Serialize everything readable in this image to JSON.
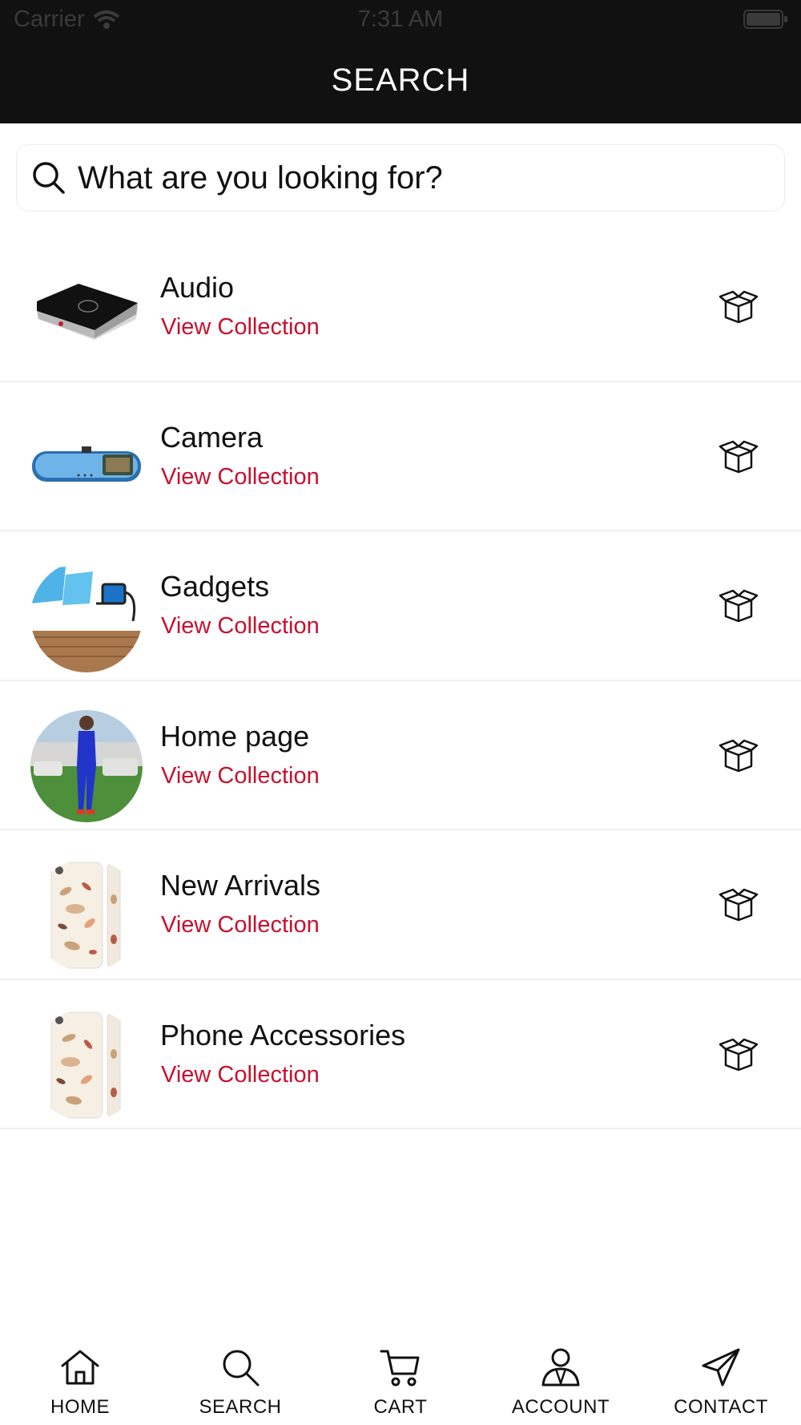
{
  "status_bar": {
    "carrier": "Carrier",
    "time": "7:31 AM"
  },
  "header": {
    "title": "SEARCH"
  },
  "search": {
    "placeholder": "What are you looking for?"
  },
  "collections": [
    {
      "title": "Audio",
      "link": "View Collection",
      "image": "bluetooth-audio-receiver"
    },
    {
      "title": "Camera",
      "link": "View Collection",
      "image": "mirror-dash-camera"
    },
    {
      "title": "Gadgets",
      "link": "View Collection",
      "image": "phone-projector-gadget"
    },
    {
      "title": "Home page",
      "link": "View Collection",
      "image": "woman-blue-outfit"
    },
    {
      "title": "New Arrivals",
      "link": "View Collection",
      "image": "patterned-phone-case"
    },
    {
      "title": "Phone Accessories",
      "link": "View Collection",
      "image": "patterned-phone-case"
    }
  ],
  "tabs": [
    {
      "label": "HOME",
      "icon": "home-icon"
    },
    {
      "label": "SEARCH",
      "icon": "search-icon"
    },
    {
      "label": "CART",
      "icon": "cart-icon"
    },
    {
      "label": "ACCOUNT",
      "icon": "account-icon"
    },
    {
      "label": "CONTACT",
      "icon": "send-icon"
    }
  ],
  "colors": {
    "header_bg": "#111111",
    "link": "#c8102e"
  }
}
